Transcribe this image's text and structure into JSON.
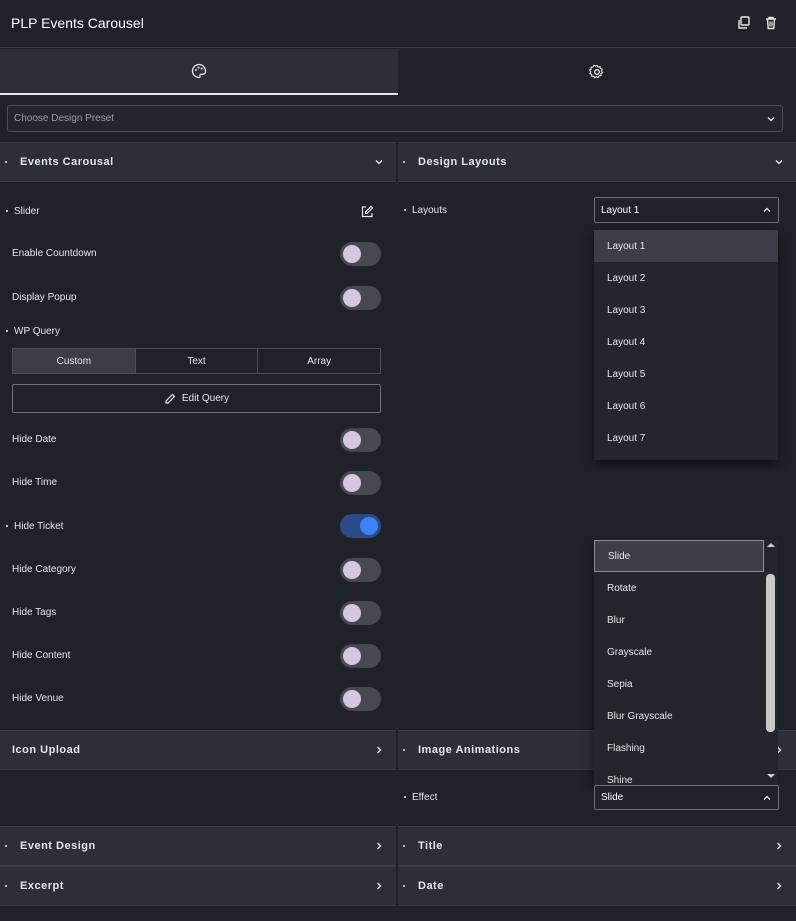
{
  "header": {
    "title": "PLP Events Carousel",
    "duplicate_icon": "copy-icon",
    "delete_icon": "trash-icon"
  },
  "tabs": [
    {
      "icon": "palette-icon"
    },
    {
      "icon": "gear-icon"
    }
  ],
  "preset": {
    "placeholder": "Choose Design Preset"
  },
  "left": {
    "section_title": "Events Carousal",
    "slider_label": "Slider",
    "enable_countdown": "Enable Countdown",
    "display_popup": "Display Popup",
    "wp_query": "WP Query",
    "query_tabs": [
      "Custom",
      "Text",
      "Array"
    ],
    "edit_query": "Edit Query",
    "toggles": [
      {
        "label": "Hide Date",
        "on": false
      },
      {
        "label": "Hide Time",
        "on": false
      },
      {
        "label": "Hide Ticket",
        "on": true
      },
      {
        "label": "Hide Category",
        "on": false
      },
      {
        "label": "Hide Tags",
        "on": false
      },
      {
        "label": "Hide Content",
        "on": false
      },
      {
        "label": "Hide Venue",
        "on": false
      }
    ],
    "icon_upload": "Icon Upload",
    "event_design": "Event Design",
    "excerpt": "Excerpt"
  },
  "right": {
    "section_title": "Design Layouts",
    "layouts_label": "Layouts",
    "layouts_value": "Layout 1",
    "layout_options": [
      "Layout 1",
      "Layout 2",
      "Layout 3",
      "Layout 4",
      "Layout 5",
      "Layout 6",
      "Layout 7"
    ],
    "effect_options": [
      "Slide",
      "Rotate",
      "Blur",
      "Grayscale",
      "Sepia",
      "Blur Grayscale",
      "Flashing",
      "Shine"
    ],
    "image_animations": "Image Animations",
    "effect_label": "Effect",
    "effect_value": "Slide",
    "title": "Title",
    "date": "Date"
  }
}
